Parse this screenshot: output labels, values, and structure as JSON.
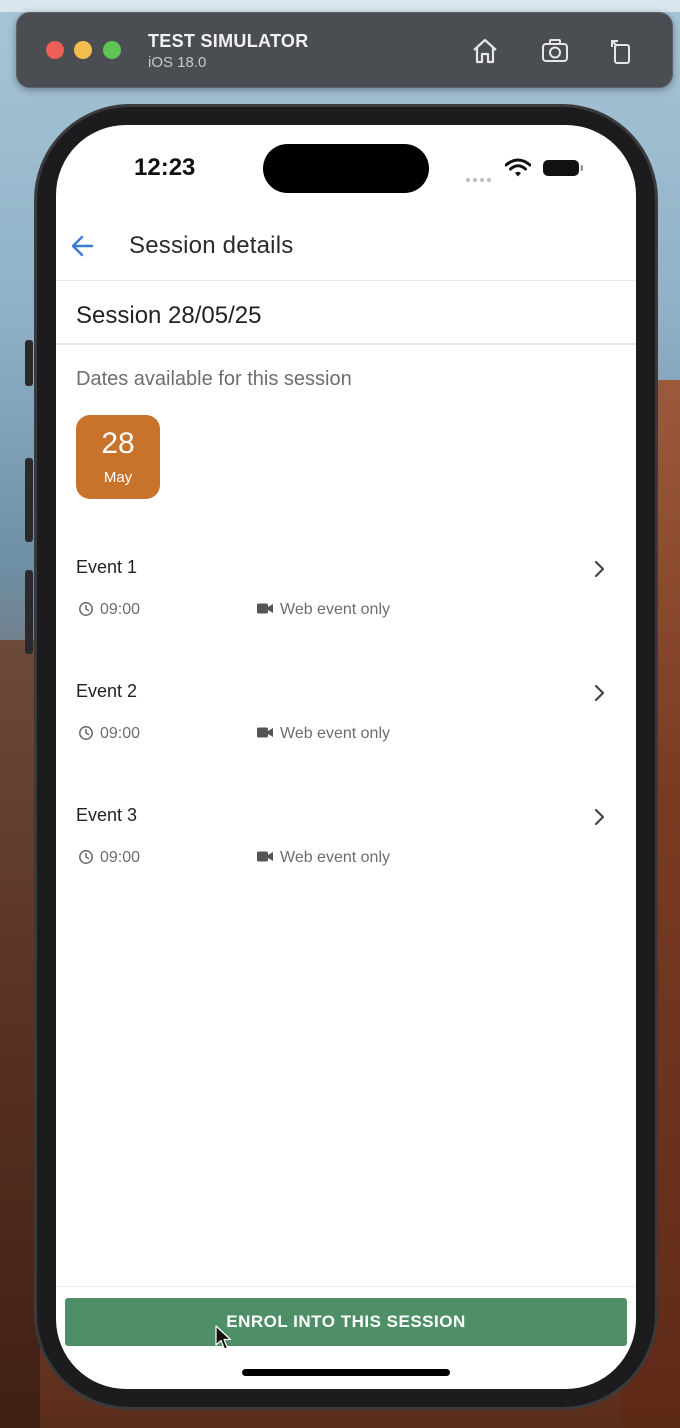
{
  "simulator": {
    "title": "TEST SIMULATOR",
    "subtitle": "iOS 18.0",
    "icons": [
      "home-icon",
      "screenshot-icon",
      "rotate-icon"
    ]
  },
  "status_bar": {
    "time": "12:23"
  },
  "header": {
    "title": "Session details"
  },
  "session": {
    "title": "Session 28/05/25",
    "dates_label": "Dates available for this session",
    "dates": [
      {
        "day": "28",
        "month": "May"
      }
    ]
  },
  "events": [
    {
      "name": "Event 1",
      "time": "09:00",
      "mode": "Web event only"
    },
    {
      "name": "Event 2",
      "time": "09:00",
      "mode": "Web event only"
    },
    {
      "name": "Event 3",
      "time": "09:00",
      "mode": "Web event only"
    }
  ],
  "footer": {
    "enrol_label": "ENROL INTO THIS SESSION"
  },
  "colors": {
    "accent_green": "#4e8f68",
    "date_tile": "#c8732b",
    "back_arrow": "#3a7bd5"
  }
}
